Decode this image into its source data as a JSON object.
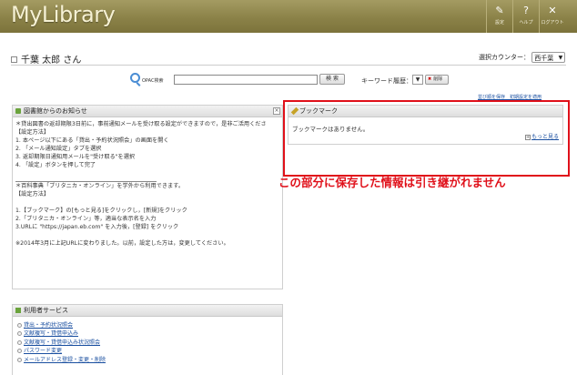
{
  "header": {
    "logo": "MyLibrary",
    "buttons": [
      {
        "icon": "wrench-icon",
        "glyph": "✎",
        "label": "設定"
      },
      {
        "icon": "help-icon",
        "glyph": "?",
        "label": "ヘルプ"
      },
      {
        "icon": "logout-icon",
        "glyph": "✕",
        "label": "ログアウト"
      }
    ]
  },
  "user": {
    "name": "千葉 太郎 さん",
    "counter_label": "選択カウンター：",
    "counter_value": "西千葉"
  },
  "search": {
    "label": "OPAC検索",
    "value": "",
    "button": "検 索",
    "history_label": "キーワード履歴：",
    "delete_button": "削除"
  },
  "layout_links": "並び順を保存　初期設定を適用",
  "notice": {
    "title": "図書館からのお知らせ",
    "close": "×",
    "lines": [
      "＊貸出図書の返却期限3日前に，事前通知メールを受け取る設定ができますので，是非ご活用くださ",
      "【設定方法】",
      "1. 本ページ以下にある「貸出・予約状況照会」の画面を開く",
      "2. 「メール通知設定」タブを選択",
      "3. 返却期限日通知用メールを\"受け取る\"を選択",
      "4. 「設定」ボタンを押して完了",
      "",
      "rule",
      "＊百科事典「ブリタニカ・オンライン」を学外から利用できます。",
      "【設定方法】",
      "",
      "1.【ブックマーク】の[もっと見る]をクリックし，[新規]をクリック",
      "2.「ブリタニカ・オンライン」等，適当な表示名を入力",
      "3.URLに \"https://japan.eb.com\" を入力後，[登録] をクリック",
      "",
      "※2014年3月に上記URLに変わりました。以前，設定した方は，変更してください。"
    ]
  },
  "bookmark": {
    "title": "ブックマーク",
    "empty_message": "ブックマークはありません。",
    "more_link": "もっと見る"
  },
  "annotation": "この部分に保存した情報は引き継がれません",
  "services": {
    "title": "利用者サービス",
    "items": [
      "貸出・予約状況照会",
      "文献複写・貸借申込み",
      "文献複写・貸借申込み状況照会",
      "パスワード変更",
      "メールアドレス登録・変更・削除"
    ]
  },
  "colors": {
    "header": "#8b8248",
    "annotation": "#e0101a",
    "link": "#1a4fa0"
  }
}
